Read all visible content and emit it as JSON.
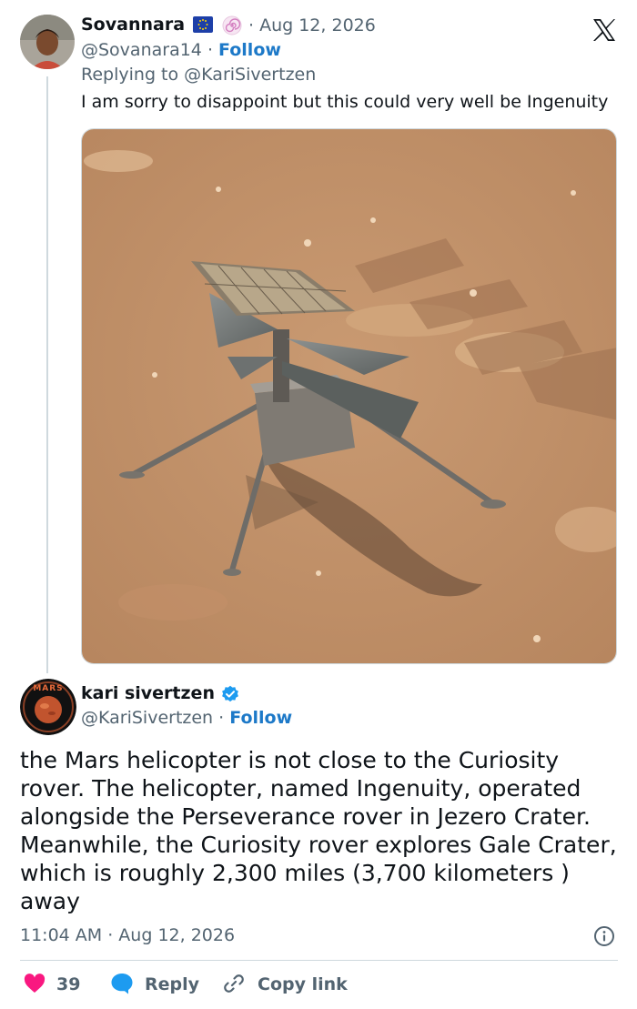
{
  "tweet1": {
    "author_name": "Sovannara",
    "date": "· Aug 12, 2026",
    "handle": "@Sovanara14",
    "follow_sep": "·",
    "follow_label": "Follow",
    "replying_prefix": "Replying to",
    "replying_to": "@KariSivertzen",
    "text": "I am sorry to disappoint but this could very well be Ingenuity",
    "image_alt": "Ingenuity Mars helicopter on Martian surface"
  },
  "tweet2": {
    "author_name": "kari sivertzen",
    "handle": "@KariSivertzen",
    "follow_sep": "·",
    "follow_label": "Follow",
    "avatar_text": "MARS",
    "text": "the Mars helicopter is not close to the Curiosity rover. The helicopter, named Ingenuity, operated alongside the Perseverance rover in Jezero Crater. Meanwhile, the Curiosity rover explores Gale Crater, which is roughly 2,300 miles (3,700 kilometers ) away",
    "timestamp": "11:04 AM · Aug 12, 2026",
    "likes": "39",
    "reply_label": "Reply",
    "copy_label": "Copy link"
  },
  "icons": {
    "x_logo": "x-logo-icon",
    "eu_flag": "eu-flag-icon",
    "spiral": "spiral-icon",
    "verified": "verified-badge-icon",
    "info": "info-icon",
    "heart": "heart-icon",
    "reply": "reply-bubble-icon",
    "link": "link-icon"
  },
  "colors": {
    "accent": "#1d9bf0",
    "like": "#f91880",
    "muted": "#536471",
    "text": "#0f1419"
  }
}
